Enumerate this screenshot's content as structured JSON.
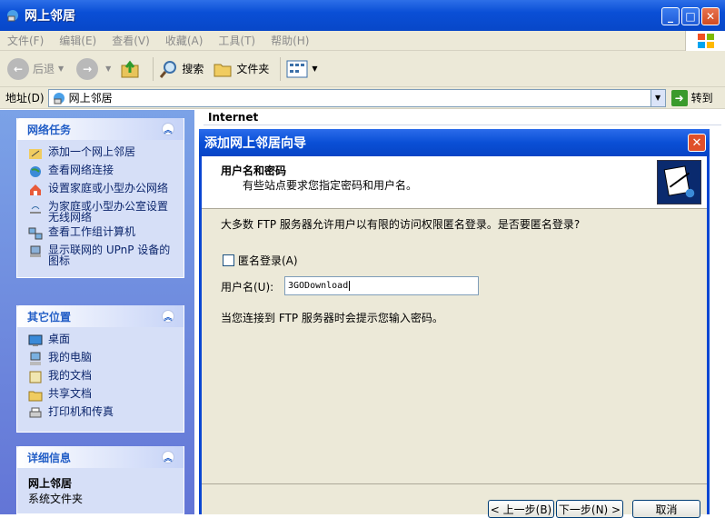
{
  "window": {
    "title": "网上邻居"
  },
  "menu": [
    "文件(F)",
    "编辑(E)",
    "查看(V)",
    "收藏(A)",
    "工具(T)",
    "帮助(H)"
  ],
  "toolbar": {
    "back": "后退",
    "search": "搜索",
    "folders": "文件夹"
  },
  "address": {
    "label": "地址(D)",
    "value": "网上邻居",
    "go": "转到"
  },
  "left": {
    "network_tasks": {
      "title": "网络任务",
      "items": [
        "添加一个网上邻居",
        "查看网络连接",
        "设置家庭或小型办公网络",
        "为家庭或小型办公室设置无线网络",
        "查看工作组计算机",
        "显示联网的 UPnP 设备的图标"
      ]
    },
    "other_places": {
      "title": "其它位置",
      "items": [
        "桌面",
        "我的电脑",
        "我的文档",
        "共享文档",
        "打印机和传真"
      ]
    },
    "details": {
      "title": "详细信息",
      "name": "网上邻居",
      "type": "系统文件夹"
    }
  },
  "main": {
    "group": "Internet"
  },
  "dialog": {
    "title": "添加网上邻居向导",
    "header_title": "用户名和密码",
    "header_sub": "有些站点要求您指定密码和用户名。",
    "question": "大多数 FTP 服务器允许用户以有限的访问权限匿名登录。是否要匿名登录?",
    "anon_label": "匿名登录(A)",
    "user_label": "用户名(U):",
    "user_value": "3GODownload",
    "note": "当您连接到 FTP 服务器时会提示您输入密码。",
    "back_btn": "< 上一步(B)",
    "next_btn": "下一步(N) >",
    "cancel_btn": "取消"
  }
}
